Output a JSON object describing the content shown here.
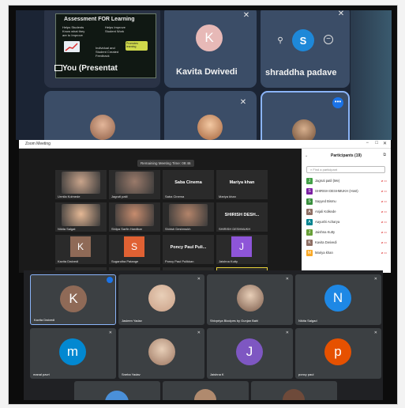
{
  "top": {
    "presentation": {
      "title": "Assessment FOR Learning",
      "lines": [
        "Helps Students",
        "Know what they",
        "are to Improve",
        "Helps Improve",
        "Student Work",
        "Individual and",
        "Student Created",
        "Feedback"
      ],
      "badge": "Promotes learning",
      "label": "You (Presentat"
    },
    "tiles": [
      {
        "name": "Kavita Dwivedi",
        "initial": "K",
        "color": "#e7b9b7"
      },
      {
        "name": "shraddha padave",
        "initial": "S",
        "color": "#1e88d8"
      }
    ]
  },
  "zoom": {
    "title": "Zoom Meeting",
    "timer": "Remaining Meeting Time: 09:46",
    "gallery": [
      {
        "name": "Urmila Kolmede",
        "type": "photo"
      },
      {
        "name": "Jagruti patil",
        "type": "photo"
      },
      {
        "name": "Saba Cinema",
        "type": "text",
        "big": "Saba Cinema"
      },
      {
        "name": "Mariya khan",
        "type": "text",
        "big": "Mariya khan"
      },
      {
        "name": "Nikita Salgat",
        "type": "photo"
      },
      {
        "name": "Shilpa Sarfin Hardikar",
        "type": "photo"
      },
      {
        "name": "Shirish Deshmukh",
        "type": "photo"
      },
      {
        "name": "SHIRISH DESHMUKH",
        "type": "text",
        "big": "SHIRISH DESH..."
      },
      {
        "name": "Kavita Dwivedi",
        "type": "avatar",
        "initial": "K",
        "color": "#8f6a57"
      },
      {
        "name": "Sugandha Patange",
        "type": "avatar",
        "initial": "S",
        "color": "#e06133"
      },
      {
        "name": "Poncy Paul Pulikkan",
        "type": "text",
        "big": "Poncy Paul Puli..."
      },
      {
        "name": "Jaishna Kutty",
        "type": "avatar",
        "initial": "J",
        "color": "#8e55d8"
      }
    ],
    "participants": {
      "heading": "Participants (19)",
      "search_placeholder": "Find a participant",
      "list": [
        {
          "name": "Jagruti patil (Me)",
          "initial": "J",
          "color": "#43a047"
        },
        {
          "name": "SHIRISH DESHMUKH (Host)",
          "initial": "S",
          "color": "#7b1fa2"
        },
        {
          "name": "Sayyed Bismu",
          "initial": "S",
          "color": "#388e3c"
        },
        {
          "name": "Anjali Kolkede",
          "initial": "A",
          "color": "#8d6e63"
        },
        {
          "name": "Aayushi Acharya",
          "initial": "A",
          "color": "#00838f"
        },
        {
          "name": "Jaishna Kutty",
          "initial": "J",
          "color": "#689f38"
        },
        {
          "name": "Kavita Dwivedi",
          "initial": "K",
          "color": "#8d6e63"
        },
        {
          "name": "Mariya khan",
          "initial": "M",
          "color": "#f9a825"
        }
      ]
    }
  },
  "bottom": {
    "tiles": [
      {
        "name": "Kavita Dwivedi",
        "initial": "K",
        "color": "#8f6a57"
      },
      {
        "name": "Jasleen Yadav",
        "initial": "",
        "color": ""
      },
      {
        "name": "Shivpriya Bloclpes by Gunjan Bahl",
        "initial": "",
        "color": ""
      },
      {
        "name": "Nikita Salgad",
        "initial": "N",
        "color": "#1e88e5"
      },
      {
        "name": "manal pavri",
        "initial": "m",
        "color": "#0288d1"
      },
      {
        "name": "Sneha Yadav",
        "initial": "",
        "color": ""
      },
      {
        "name": "Jaishna K",
        "initial": "J",
        "color": "#7e57c2"
      },
      {
        "name": "poncy paul",
        "initial": "p",
        "color": "#e65100"
      }
    ]
  }
}
